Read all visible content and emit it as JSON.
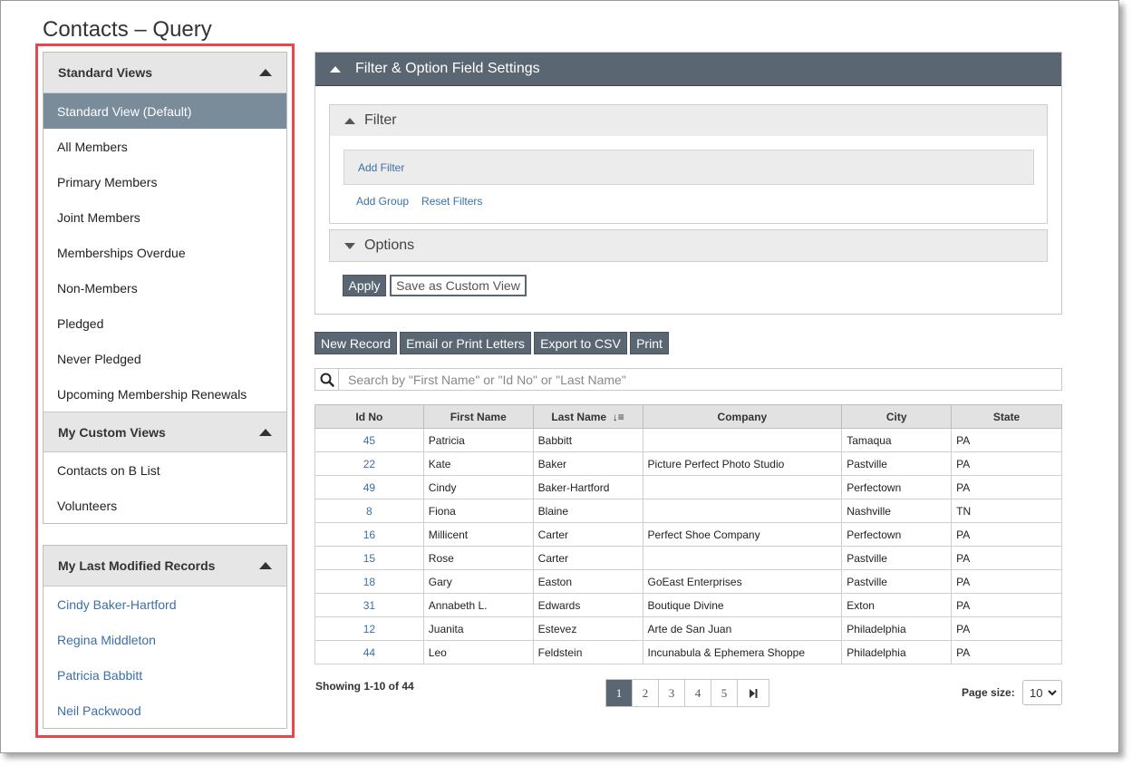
{
  "page_title": "Contacts – Query",
  "sidebar": {
    "standard_views": {
      "title": "Standard Views",
      "items": [
        "Standard View (Default)",
        "All Members",
        "Primary Members",
        "Joint Members",
        "Memberships Overdue",
        "Non-Members",
        "Pledged",
        "Never Pledged",
        "Upcoming Membership Renewals"
      ],
      "active_index": 0
    },
    "custom_views": {
      "title": "My Custom Views",
      "items": [
        "Contacts on B List",
        "Volunteers"
      ]
    },
    "last_modified": {
      "title": "My Last Modified Records",
      "items": [
        "Cindy Baker-Hartford",
        "Regina Middleton",
        "Patricia Babbitt",
        "Neil Packwood"
      ]
    }
  },
  "settings": {
    "title": "Filter & Option Field Settings",
    "filter_title": "Filter",
    "add_filter": "Add Filter",
    "add_group": "Add Group",
    "reset_filters": "Reset Filters",
    "options_title": "Options",
    "apply": "Apply",
    "save_custom": "Save as Custom View"
  },
  "toolbar": {
    "new_record": "New Record",
    "email_print": "Email or Print Letters",
    "export_csv": "Export to CSV",
    "print": "Print"
  },
  "search": {
    "placeholder": "Search by \"First Name\" or \"Id No\" or \"Last Name\""
  },
  "table": {
    "columns": [
      "Id No",
      "First Name",
      "Last Name",
      "Company",
      "City",
      "State"
    ],
    "sorted_column": "Last Name",
    "rows": [
      [
        "45",
        "Patricia",
        "Babbitt",
        "",
        "Tamaqua",
        "PA"
      ],
      [
        "22",
        "Kate",
        "Baker",
        "Picture Perfect Photo Studio",
        "Pastville",
        "PA"
      ],
      [
        "49",
        "Cindy",
        "Baker-Hartford",
        "",
        "Perfectown",
        "PA"
      ],
      [
        "8",
        "Fiona",
        "Blaine",
        "",
        "Nashville",
        "TN"
      ],
      [
        "16",
        "Millicent",
        "Carter",
        "Perfect Shoe Company",
        "Perfectown",
        "PA"
      ],
      [
        "15",
        "Rose",
        "Carter",
        "",
        "Pastville",
        "PA"
      ],
      [
        "18",
        "Gary",
        "Easton",
        "GoEast Enterprises",
        "Pastville",
        "PA"
      ],
      [
        "31",
        "Annabeth L.",
        "Edwards",
        "Boutique Divine",
        "Exton",
        "PA"
      ],
      [
        "12",
        "Juanita",
        "Estevez",
        "Arte de San Juan",
        "Philadelphia",
        "PA"
      ],
      [
        "44",
        "Leo",
        "Feldstein",
        "Incunabula & Ephemera Shoppe",
        "Philadelphia",
        "PA"
      ]
    ]
  },
  "footer": {
    "showing": "Showing 1-10 of 44",
    "pages": [
      "1",
      "2",
      "3",
      "4",
      "5"
    ],
    "page_size_label": "Page size:",
    "page_size_value": "10"
  },
  "colors": {
    "highlight_border": "#e8474d",
    "header_dark": "#5a6672",
    "active_item": "#7a8b9a",
    "link": "#3a6fa8"
  }
}
